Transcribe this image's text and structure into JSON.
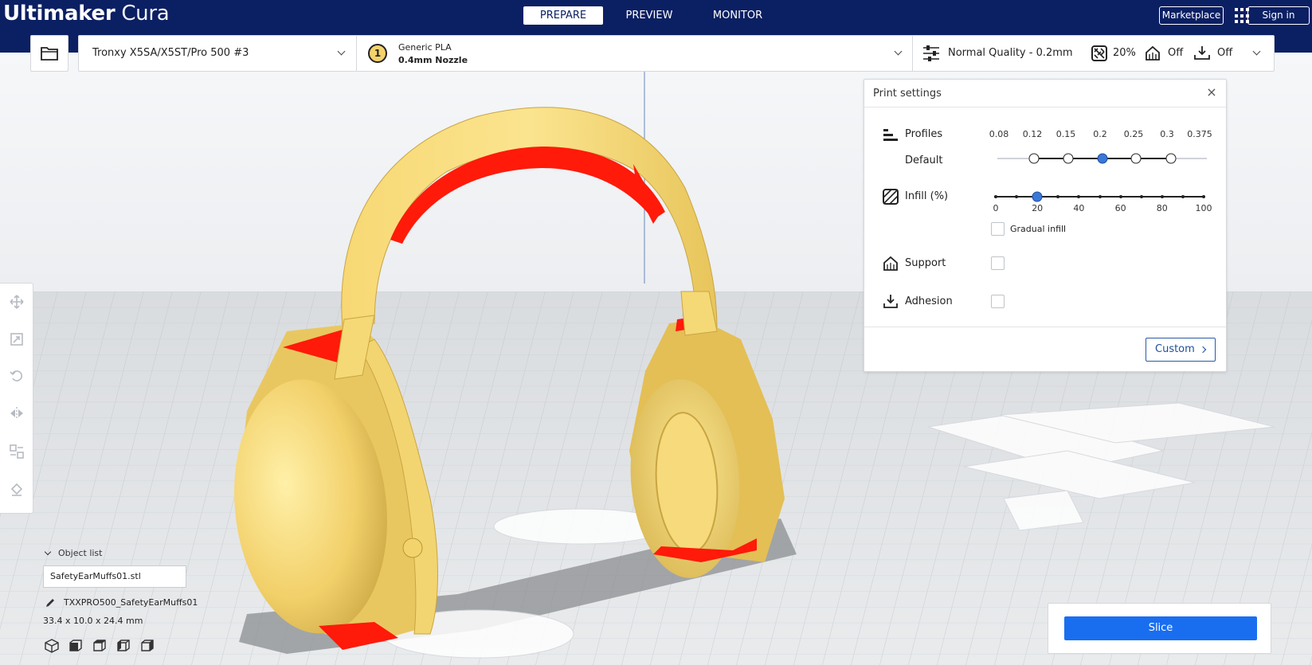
{
  "app": {
    "brand": "Ultimaker",
    "product": "Cura"
  },
  "stages": [
    {
      "label": "PREPARE",
      "active": true
    },
    {
      "label": "PREVIEW",
      "active": false
    },
    {
      "label": "MONITOR",
      "active": false
    }
  ],
  "header": {
    "marketplace_label": "Marketplace",
    "signin_label": "Sign in"
  },
  "printer": {
    "name": "Tronxy X5SA/X5ST/Pro 500 #3"
  },
  "extruder": {
    "number": "1",
    "material": "Generic PLA",
    "nozzle": "0.4mm Nozzle"
  },
  "quality": {
    "profile": "Normal Quality - 0.2mm",
    "infill": "20%",
    "support": "Off",
    "adhesion": "Off"
  },
  "print_settings": {
    "title": "Print settings",
    "profiles": {
      "label": "Profiles",
      "sublabel": "Default",
      "ticks": [
        "0.08",
        "0.12",
        "0.15",
        "0.2",
        "0.25",
        "0.3",
        "0.375"
      ],
      "selected": "0.2"
    },
    "infill": {
      "label": "Infill (%)",
      "ticks": [
        "0",
        "20",
        "40",
        "60",
        "80",
        "100"
      ],
      "value": 20,
      "gradual_label": "Gradual infill"
    },
    "support": {
      "label": "Support",
      "checked": false
    },
    "adhesion": {
      "label": "Adhesion",
      "checked": false
    },
    "custom_label": "Custom"
  },
  "object_list": {
    "toggle_label": "Object list",
    "file": "SafetyEarMuffs01.stl",
    "job_name": "TXXPRO500_SafetyEarMuffs01",
    "dimensions": "33.4 x 10.0 x 24.4 mm"
  },
  "slice": {
    "label": "Slice"
  },
  "colors": {
    "topbar": "#0b1f63",
    "model": "#f5d976",
    "overhang": "#ff1a0a",
    "accent": "#196ef0"
  }
}
